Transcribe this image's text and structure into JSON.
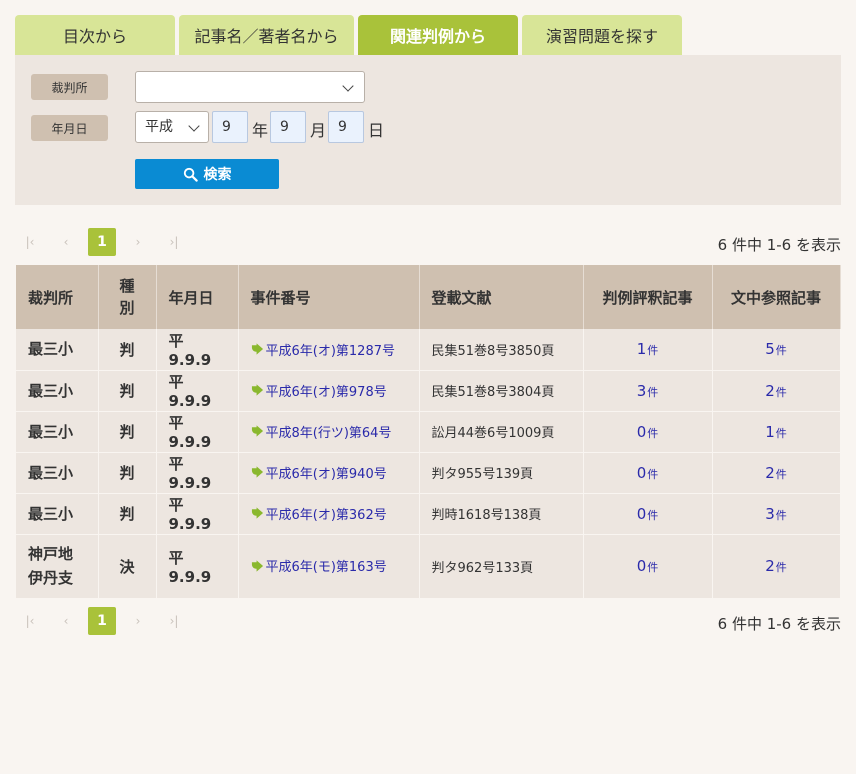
{
  "tabs": [
    {
      "label": "目次から",
      "active": false
    },
    {
      "label": "記事名／著者名から",
      "active": false
    },
    {
      "label": "関連判例から",
      "active": true
    },
    {
      "label": "演習問題を探す",
      "active": false
    }
  ],
  "search": {
    "court_label": "裁判所",
    "court_value": "",
    "date_label": "年月日",
    "era_value": "平成",
    "year_value": "9",
    "year_unit": "年",
    "month_value": "9",
    "month_unit": "月",
    "day_value": "9",
    "day_unit": "日",
    "button_label": "検索"
  },
  "pagination": {
    "first": "|‹",
    "prev": "‹",
    "current": "1",
    "next": "›",
    "last": "›|",
    "summary": "6 件中 1-6 を表示"
  },
  "table": {
    "headers": [
      "裁判所",
      "種別",
      "年月日",
      "事件番号",
      "登載文献",
      "判例評釈記事",
      "文中参照記事"
    ],
    "count_unit": "件",
    "rows": [
      {
        "court": "最三小",
        "type": "判",
        "date": "平9.9.9",
        "case": "平成6年(オ)第1287号",
        "source": "民集51巻8号3850頁",
        "commentary": "1",
        "references": "5"
      },
      {
        "court": "最三小",
        "type": "判",
        "date": "平9.9.9",
        "case": "平成6年(オ)第978号",
        "source": "民集51巻8号3804頁",
        "commentary": "3",
        "references": "2"
      },
      {
        "court": "最三小",
        "type": "判",
        "date": "平9.9.9",
        "case": "平成8年(行ツ)第64号",
        "source": "訟月44巻6号1009頁",
        "commentary": "0",
        "references": "1"
      },
      {
        "court": "最三小",
        "type": "判",
        "date": "平9.9.9",
        "case": "平成6年(オ)第940号",
        "source": "判タ955号139頁",
        "commentary": "0",
        "references": "2"
      },
      {
        "court": "最三小",
        "type": "判",
        "date": "平9.9.9",
        "case": "平成6年(オ)第362号",
        "source": "判時1618号138頁",
        "commentary": "0",
        "references": "3"
      },
      {
        "court": "神戸地伊丹支",
        "type": "決",
        "date": "平9.9.9",
        "case": "平成6年(モ)第163号",
        "source": "判タ962号133頁",
        "commentary": "0",
        "references": "2"
      }
    ]
  },
  "colors": {
    "tab_inactive": "#d8e597",
    "tab_active": "#a9c23a",
    "panel_bg": "#ede6e0",
    "header_bg": "#cfc0b0",
    "button_blue": "#0a8bd3",
    "link": "#2a2aaa",
    "arrow_green": "#8ab82e"
  },
  "icons": {
    "search": "search-icon",
    "case_arrow": "arrow-right-icon",
    "select": "chevron-down-icon"
  }
}
